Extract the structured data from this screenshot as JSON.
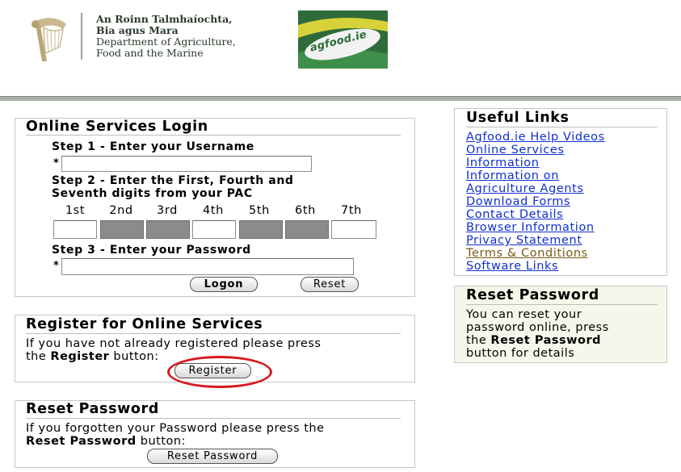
{
  "header": {
    "dept_lines": [
      "An Roinn Talmhaíochta,",
      "Bia agus Mara",
      "Department of Agriculture,",
      "Food and the Marine"
    ],
    "logo_text": "agfood.ie"
  },
  "login": {
    "title": "Online Services Login",
    "step1": "Step 1 - Enter your Username",
    "step2_line1": "Step 2 - Enter the First, Fourth and",
    "step2_line2": "Seventh digits from your PAC",
    "pac_labels": [
      "1st",
      "2nd",
      "3rd",
      "4th",
      "5th",
      "6th",
      "7th"
    ],
    "step3": "Step 3 - Enter your Password",
    "required_mark": "*",
    "username_value": "",
    "password_value": "",
    "logon_label": "Logon",
    "reset_label": "Reset"
  },
  "register": {
    "title": "Register for Online Services",
    "line1": "If you have not already registered please press",
    "line2_pre": "the ",
    "line2_bold": "Register",
    "line2_post": " button:",
    "button_label": "Register"
  },
  "reset_pw": {
    "title": "Reset Password",
    "line1": "If you forgotten your Password please press the",
    "line2_bold": "Reset Password",
    "line2_post": " button:",
    "button_label": "Reset Password"
  },
  "useful_links": {
    "title": "Useful Links",
    "items": [
      "Agfood.ie Help Videos",
      "Online Services",
      "Information",
      "Information on",
      "Agriculture Agents",
      "Download Forms",
      "Contact Details",
      "Browser Information",
      "Privacy Statement",
      "Terms & Conditions",
      "Software Links"
    ]
  },
  "reset_side": {
    "title": "Reset Password",
    "line1": "You can reset your",
    "line2": "password online, press",
    "line3_pre": "the ",
    "line3_bold": "Reset Password",
    "line4": "button for details"
  },
  "colors": {
    "link": "#0f2fd0",
    "visited_link": "#7a5a14",
    "highlight_oval": "#d8191f",
    "logo_green": "#2f6b3a"
  }
}
